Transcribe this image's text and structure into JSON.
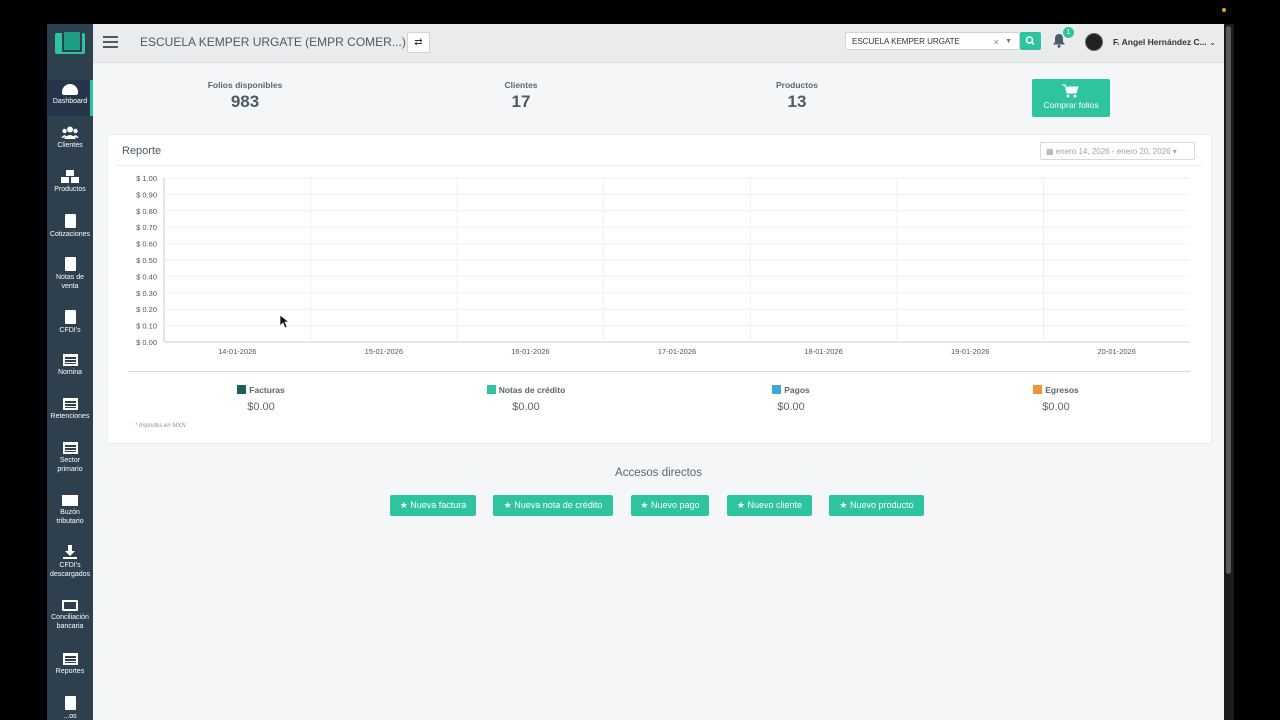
{
  "sidebar": {
    "items": [
      {
        "label": "Dashboard",
        "icon": "dashboard-icon"
      },
      {
        "label": "Clientes",
        "icon": "users-icon"
      },
      {
        "label": "Productos",
        "icon": "cubes-icon"
      },
      {
        "label": "Cotizaciones",
        "icon": "document-icon"
      },
      {
        "label": "Notas de venta",
        "icon": "document-icon"
      },
      {
        "label": "CFDI's",
        "icon": "document-text-icon"
      },
      {
        "label": "Nomina",
        "icon": "list-icon"
      },
      {
        "label": "Retenciones",
        "icon": "list-icon"
      },
      {
        "label": "Sector primario",
        "icon": "list-icon"
      },
      {
        "label": "Buzón tributario",
        "icon": "mail-icon"
      },
      {
        "label": "CFDI's descargados",
        "icon": "download-icon"
      },
      {
        "label": "Conciliación bancaria",
        "icon": "cash-icon"
      },
      {
        "label": "Reportes",
        "icon": "list-icon"
      },
      {
        "label": "...os",
        "icon": "document-icon"
      }
    ]
  },
  "header": {
    "company": "ESCUELA KEMPER URGATE (EMPR COMER...)",
    "company_select": "ESCUELA KEMPER URGATE",
    "clear_symbol": "×",
    "notification_count": "1",
    "user_name": "F. Angel Hernández C..."
  },
  "stats": {
    "folios_label": "Folios disponibles",
    "folios_value": "983",
    "clientes_label": "Clientes",
    "clientes_value": "17",
    "productos_label": "Productos",
    "productos_value": "13",
    "buy_label": "Comprar folios"
  },
  "report": {
    "title": "Reporte",
    "date_range": "enero 14, 2026 - enero 20, 2026",
    "legend": [
      {
        "name": "Facturas",
        "amount": "$0.00",
        "color": "#1e5f5a"
      },
      {
        "name": "Notas de crédito",
        "amount": "$0.00",
        "color": "#2ec4a0"
      },
      {
        "name": "Pagos",
        "amount": "$0.00",
        "color": "#3ea6d8"
      },
      {
        "name": "Egresos",
        "amount": "$0.00",
        "color": "#f0953a"
      }
    ],
    "note": "* Importes en MXN"
  },
  "chart_data": {
    "type": "line",
    "x": [
      "14-01-2026",
      "15-01-2026",
      "16-01-2026",
      "17-01-2026",
      "18-01-2026",
      "19-01-2026",
      "20-01-2026"
    ],
    "y_ticks": [
      "$ 0.00",
      "$ 0.10",
      "$ 0.20",
      "$ 0.30",
      "$ 0.40",
      "$ 0.50",
      "$ 0.60",
      "$ 0.70",
      "$ 0.80",
      "$ 0.90",
      "$ 1.00"
    ],
    "ylim": [
      0,
      1
    ],
    "grid": true,
    "series": [
      {
        "name": "Facturas",
        "values": [
          0,
          0,
          0,
          0,
          0,
          0,
          0
        ]
      },
      {
        "name": "Notas de crédito",
        "values": [
          0,
          0,
          0,
          0,
          0,
          0,
          0
        ]
      },
      {
        "name": "Pagos",
        "values": [
          0,
          0,
          0,
          0,
          0,
          0,
          0
        ]
      },
      {
        "name": "Egresos",
        "values": [
          0,
          0,
          0,
          0,
          0,
          0,
          0
        ]
      }
    ]
  },
  "shortcuts": {
    "title": "Accesos directos",
    "buttons": [
      "Nueva factura",
      "Nueva nota de crédito",
      "Nuevo pago",
      "Nuevo cliente",
      "Nuevo producto"
    ]
  }
}
